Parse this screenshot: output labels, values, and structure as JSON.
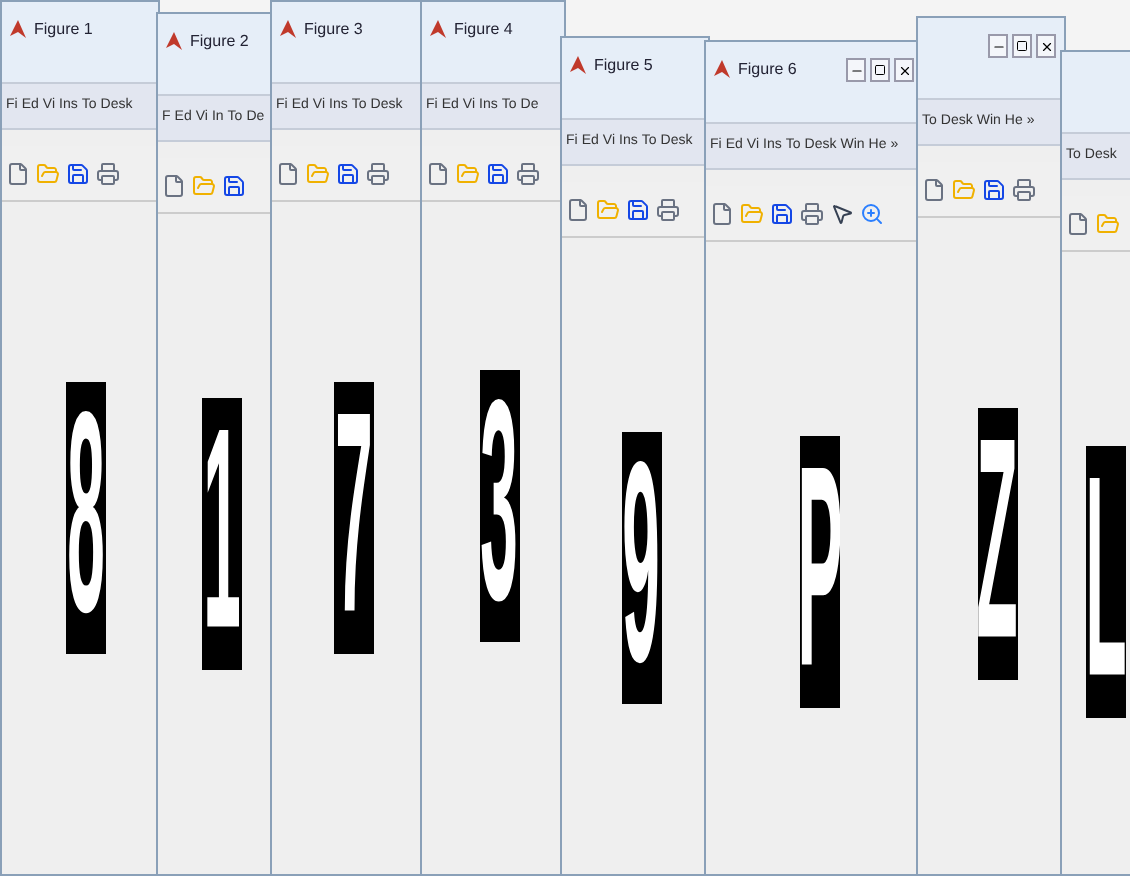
{
  "windows": [
    {
      "title": "Figure 1",
      "window_buttons": false,
      "menu": [
        "Fi",
        "Ed",
        "Vi",
        "Ins",
        "To",
        "Desk"
      ],
      "glyph": "8"
    },
    {
      "title": "Figure 2",
      "window_buttons": false,
      "menu": [
        "F",
        "Ed",
        "Vi",
        "In",
        "To",
        "De"
      ],
      "glyph": "1"
    },
    {
      "title": "Figure 3",
      "window_buttons": false,
      "menu": [
        "Fi",
        "Ed",
        "Vi",
        "Ins",
        "To",
        "Desk"
      ],
      "glyph": "7"
    },
    {
      "title": "Figure 4",
      "window_buttons": false,
      "menu": [
        "Fi",
        "Ed",
        "Vi",
        "Ins",
        "To",
        "De"
      ],
      "glyph": "3"
    },
    {
      "title": "Figure 5",
      "window_buttons": false,
      "menu": [
        "Fi",
        "Ed",
        "Vi",
        "Ins",
        "To",
        "Desk"
      ],
      "glyph": "9"
    },
    {
      "title": "Figure 6",
      "window_buttons": true,
      "menu": [
        "Fi",
        "Ed",
        "Vi",
        "Ins",
        "To",
        "Desk",
        "Win",
        "He",
        "»"
      ],
      "glyph": "P"
    },
    {
      "window_buttons": true,
      "menu": [
        "To",
        "Desk",
        "Win",
        "He",
        "»"
      ],
      "glyph": "Z"
    },
    {
      "window_buttons": false,
      "menu": [
        "To",
        "Desk"
      ],
      "glyph": "L"
    }
  ]
}
